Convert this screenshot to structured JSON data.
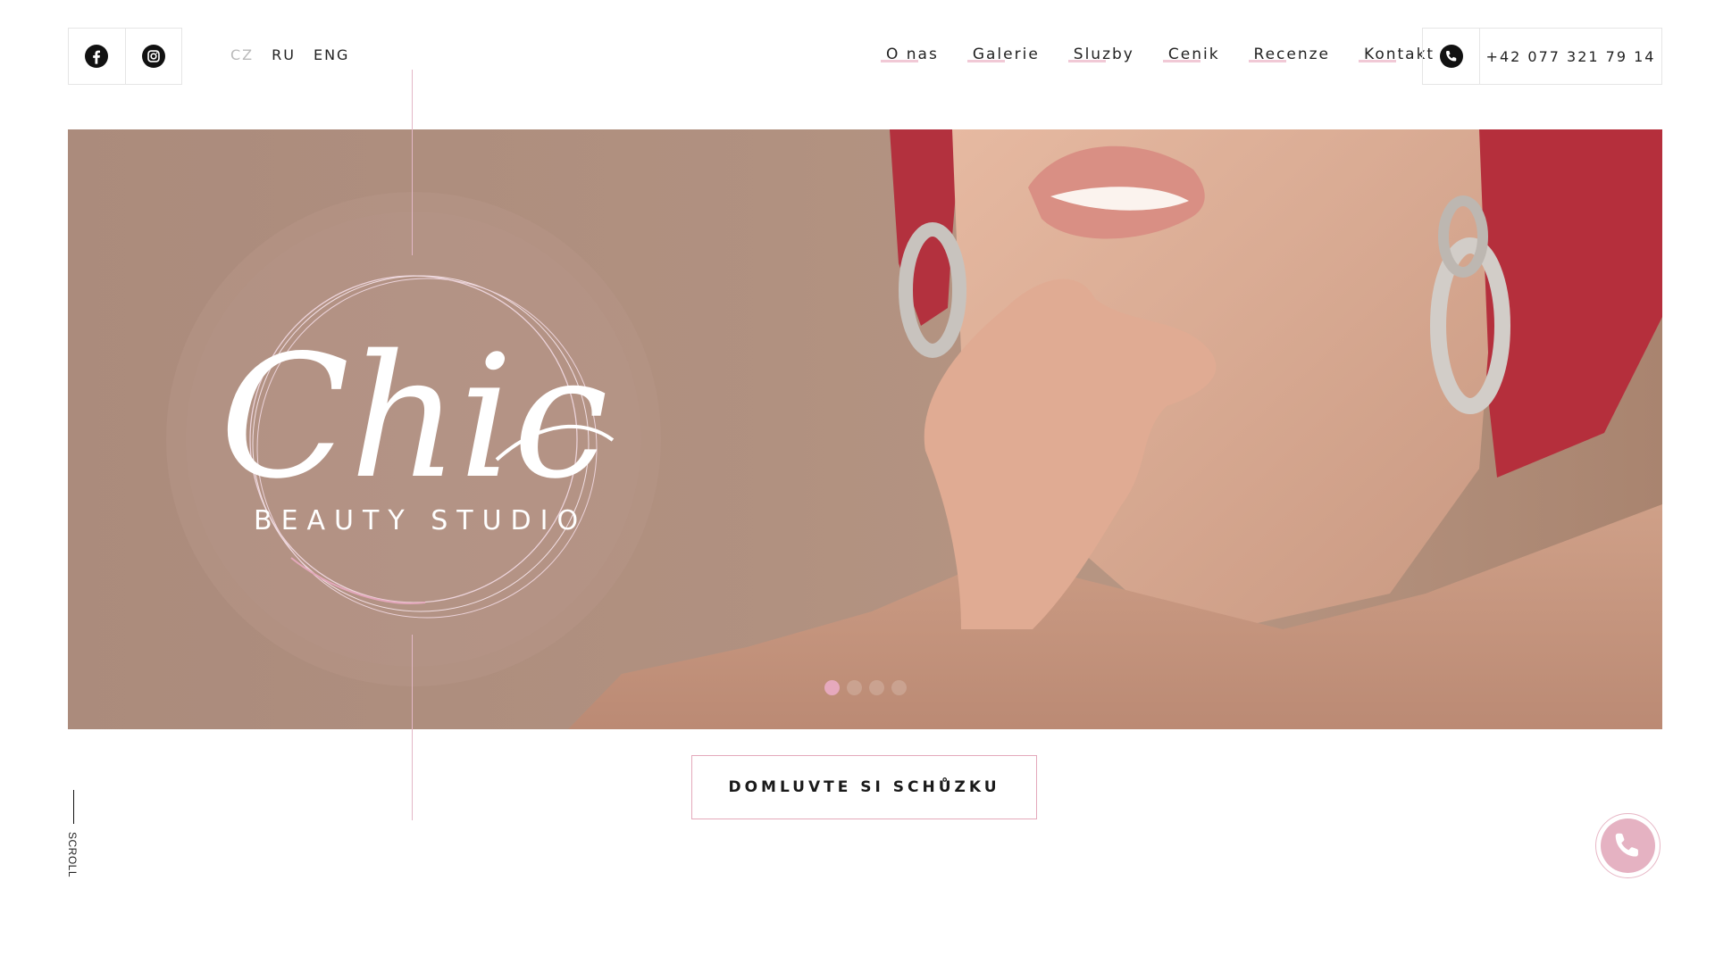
{
  "social": {
    "facebook_icon": "facebook-icon",
    "instagram_icon": "instagram-icon"
  },
  "languages": [
    {
      "label": "CZ",
      "active": true
    },
    {
      "label": "RU",
      "active": false
    },
    {
      "label": "ENG",
      "active": false
    }
  ],
  "nav": {
    "items": [
      "O nas",
      "Galerie",
      "Sluzby",
      "Cenik",
      "Recenze",
      "Kontakt"
    ]
  },
  "contact": {
    "phone_icon": "phone-icon",
    "phone": "+42 077 321 79 14"
  },
  "hero": {
    "logo_script": "Chic",
    "logo_subtitle": "BEAUTY STUDIO",
    "slides_total": 4,
    "slide_active": 1
  },
  "cta": {
    "label": "DOMLUVTE SI SCHŮZKU"
  },
  "scroll": {
    "label": "SCROLL"
  },
  "colors": {
    "accent_pink": "#e5b2c2",
    "hero_bg": "#b19180",
    "text": "#1a1a1a"
  }
}
